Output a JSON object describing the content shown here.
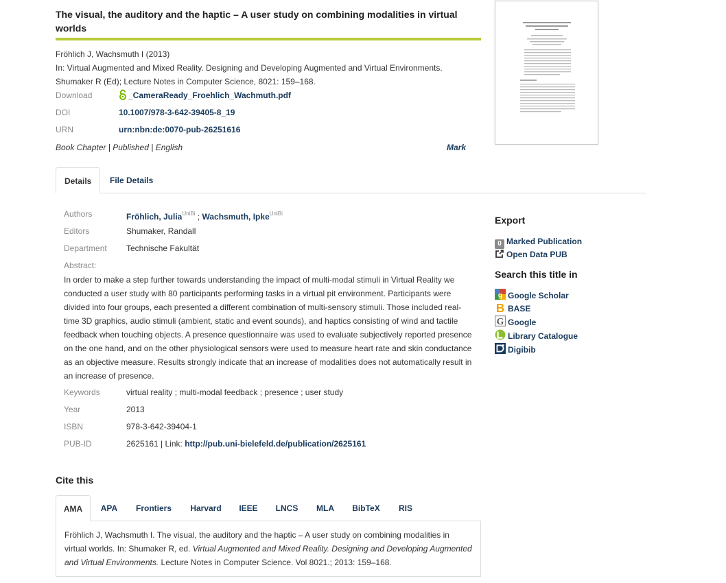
{
  "title": "The visual, the auditory and the haptic – A user study on combining modalities in virtual worlds",
  "citation": {
    "line1": "Fröhlich J, Wachsmuth I (2013)",
    "line2": "In: Virtual Augmented and Mixed Reality. Designing and Developing Augmented and Virtual Environments.",
    "line3": "Shumaker R (Ed); Lecture Notes in Computer Science, 8021: 159–168."
  },
  "meta": {
    "download_label": "Download",
    "download_value": "_CameraReady_Froehlich_Wachmuth.pdf",
    "doi_label": "DOI",
    "doi_value": "10.1007/978-3-642-39405-8_19",
    "urn_label": "URN",
    "urn_value": "urn:nbn:de:0070-pub-26251616"
  },
  "pubinfo": {
    "type": "Book Chapter",
    "sep1": " | ",
    "status": "Published",
    "sep2": " | ",
    "language": "English",
    "mark": "Mark"
  },
  "tabs": [
    "Details",
    "File Details"
  ],
  "details": {
    "authors_label": "Authors",
    "author1": "Fröhlich, Julia",
    "author1_sup": "UniBi",
    "author_sep": " ; ",
    "author2": "Wachsmuth, Ipke",
    "author2_sup": "UniBi",
    "editors_label": "Editors",
    "editors_value": "Shumaker, Randall",
    "department_label": "Department",
    "department_value": "Technische Fakultät",
    "abstract_label": "Abstract:",
    "abstract": "In order to make a step further towards understanding the impact of multi-modal stimuli in Virtual Reality we conducted a user study with 80 participants performing tasks in a virtual pit environment. Participants were divided into four groups, each presented a different combination of multi-sensory stimuli. Those included real-time 3D graphics, audio stimuli (ambient, static and event sounds), and haptics consisting of wind and tactile feedback when touching objects. A presence questionnaire was used to evaluate subjectively reported presence on the one hand, and on the other physiological sensors were used to measure heart rate and skin conductance as an objective measure. Results strongly indicate that an increase of modalities does not automatically result in an increase of presence.",
    "keywords_label": "Keywords",
    "keywords_value": "virtual reality ; multi-modal feedback ; presence ; user study",
    "year_label": "Year",
    "year_value": "2013",
    "isbn_label": "ISBN",
    "isbn_value": "978-3-642-39404-1",
    "pubid_label": "PUB-ID",
    "pubid_value": "2625161 | Link: ",
    "pubid_link": "http://pub.uni-bielefeld.de/publication/2625161"
  },
  "sidebar": {
    "export_heading": "Export",
    "marked_count": "0",
    "marked_label": "Marked Publication",
    "open_data_label": "Open Data PUB",
    "search_heading": "Search this title in",
    "search_items": [
      "Google Scholar",
      "BASE",
      "Google",
      "Library Catalogue",
      "Digibib"
    ]
  },
  "cite": {
    "heading": "Cite this",
    "tabs": [
      "AMA",
      "APA",
      "Frontiers",
      "Harvard",
      "IEEE",
      "LNCS",
      "MLA",
      "BibTeX",
      "RIS"
    ],
    "text_before": "Fröhlich J, Wachsmuth I. The visual, the auditory and the haptic – A user study on combining modalities in virtual worlds. In: Shumaker R, ed. ",
    "text_italic": "Virtual Augmented and Mixed Reality. Designing and Developing Augmented and Virtual Environments.",
    "text_after": " Lecture Notes in Computer Science. Vol 8021.; 2013: 159–168."
  },
  "colors": {
    "accent_rule": "#b9ca3a",
    "link": "#1a3a5c",
    "label_gray": "#8a8a8a",
    "open_access": "#7ab800"
  }
}
